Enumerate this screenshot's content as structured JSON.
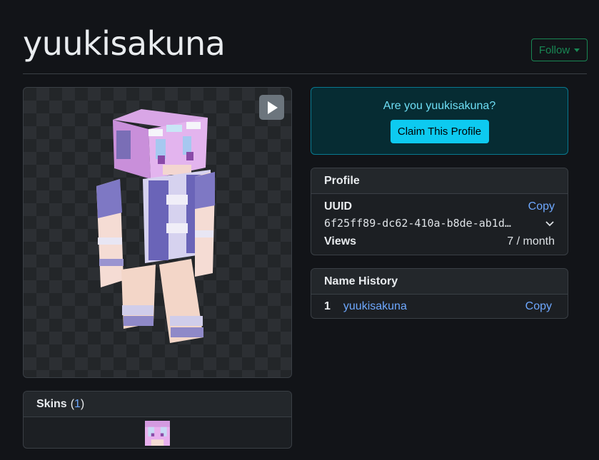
{
  "profile": {
    "username": "yuukisakuna",
    "follow_label": "Follow"
  },
  "claim": {
    "question": "Are you yuukisakuna?",
    "button_label": "Claim This Profile"
  },
  "profile_card": {
    "title": "Profile",
    "uuid_label": "UUID",
    "uuid_copy": "Copy",
    "uuid_value": "6f25ff89-dc62-410a-b8de-ab1d…",
    "views_label": "Views",
    "views_value": "7 / month"
  },
  "name_history": {
    "title": "Name History",
    "entries": [
      {
        "index": "1",
        "name": "yuukisakuna",
        "copy": "Copy"
      }
    ]
  },
  "skins": {
    "title": "Skins",
    "count": "1"
  },
  "icons": {
    "play": "play-icon",
    "dropdown": "caret-down-icon",
    "expand": "chevron-down-icon"
  },
  "colors": {
    "background": "#121418",
    "follow": "#198754",
    "claim_bg": "#062c33",
    "claim_text": "#6edff6",
    "claim_button": "#0dcaf0",
    "link": "#6ea8fe"
  }
}
